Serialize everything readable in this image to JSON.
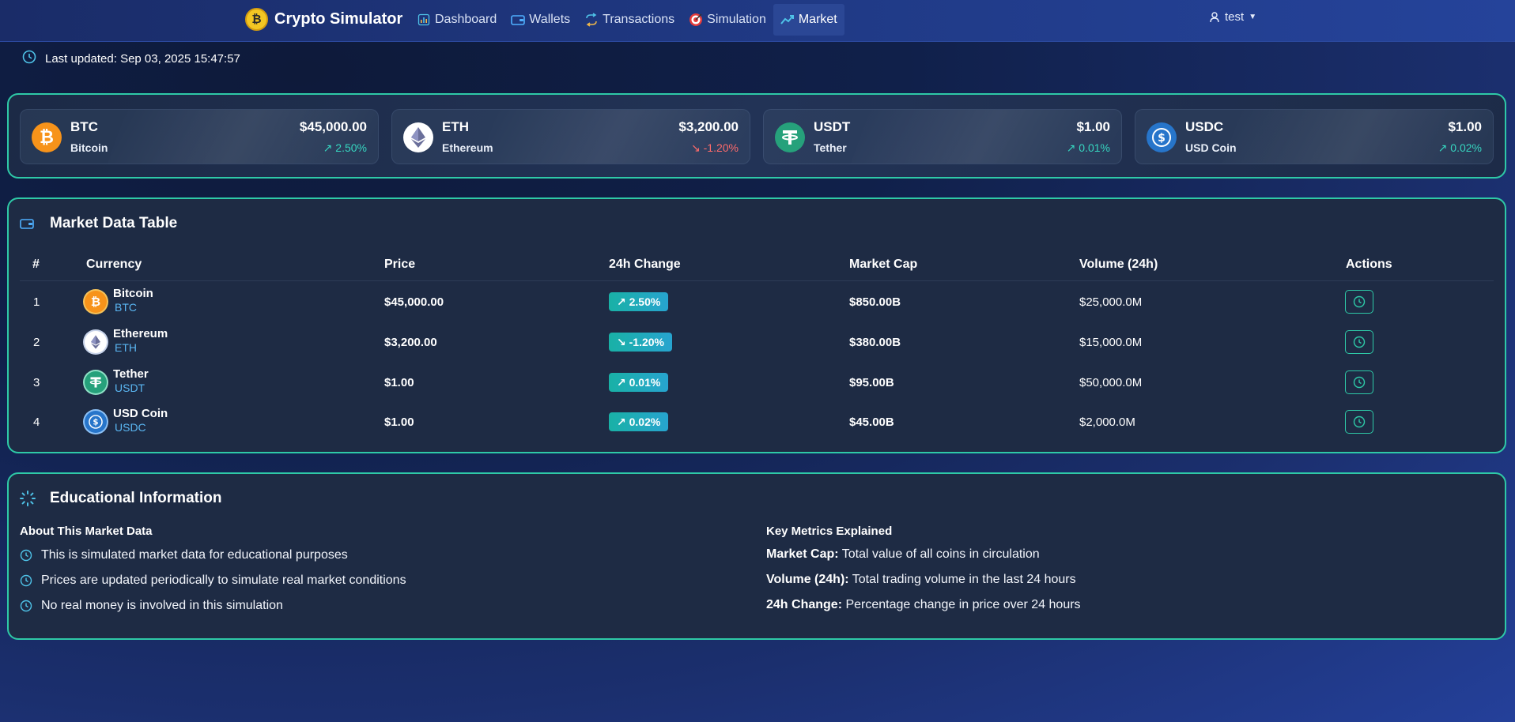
{
  "nav": {
    "brand": "Crypto Simulator",
    "items": [
      {
        "label": "Dashboard",
        "icon": "bar-chart-icon"
      },
      {
        "label": "Wallets",
        "icon": "wallet-icon"
      },
      {
        "label": "Transactions",
        "icon": "arrows-swap-icon"
      },
      {
        "label": "Simulation",
        "icon": "target-icon"
      },
      {
        "label": "Market",
        "icon": "trend-icon"
      }
    ],
    "active": "Market",
    "user": "test"
  },
  "last_updated": "Last updated: Sep 03, 2025 15:47:57",
  "ticker": [
    {
      "symbol": "BTC",
      "name": "Bitcoin",
      "price": "$45,000.00",
      "change": "↗ 2.50%",
      "direction": "up",
      "color": "#f7931a"
    },
    {
      "symbol": "ETH",
      "name": "Ethereum",
      "price": "$3,200.00",
      "change": "↘ -1.20%",
      "direction": "down",
      "color": "#ffffff"
    },
    {
      "symbol": "USDT",
      "name": "Tether",
      "price": "$1.00",
      "change": "↗ 0.01%",
      "direction": "up",
      "color": "#26a17b"
    },
    {
      "symbol": "USDC",
      "name": "USD Coin",
      "price": "$1.00",
      "change": "↗ 0.02%",
      "direction": "up",
      "color": "#2775ca"
    }
  ],
  "market_table": {
    "title": "Market Data Table",
    "columns": [
      "#",
      "Currency",
      "Price",
      "24h Change",
      "Market Cap",
      "Volume (24h)",
      "Actions"
    ],
    "rows": [
      {
        "rank": "1",
        "name": "Bitcoin",
        "symbol": "BTC",
        "price": "$45,000.00",
        "change": "↗ 2.50%",
        "market_cap": "$850.00B",
        "volume": "$25,000.0M"
      },
      {
        "rank": "2",
        "name": "Ethereum",
        "symbol": "ETH",
        "price": "$3,200.00",
        "change": "↘ -1.20%",
        "market_cap": "$380.00B",
        "volume": "$15,000.0M"
      },
      {
        "rank": "3",
        "name": "Tether",
        "symbol": "USDT",
        "price": "$1.00",
        "change": "↗ 0.01%",
        "market_cap": "$95.00B",
        "volume": "$50,000.0M"
      },
      {
        "rank": "4",
        "name": "USD Coin",
        "symbol": "USDC",
        "price": "$1.00",
        "change": "↗ 0.02%",
        "market_cap": "$45.00B",
        "volume": "$2,000.0M"
      }
    ]
  },
  "education": {
    "title": "Educational Information",
    "about_heading": "About This Market Data",
    "about_items": [
      "This is simulated market data for educational purposes",
      "Prices are updated periodically to simulate real market conditions",
      "No real money is involved in this simulation"
    ],
    "metrics_heading": "Key Metrics Explained",
    "metrics": [
      {
        "term": "Market Cap:",
        "desc": "Total value of all coins in circulation"
      },
      {
        "term": "Volume (24h):",
        "desc": "Total trading volume in the last 24 hours"
      },
      {
        "term": "24h Change:",
        "desc": "Percentage change in price over 24 hours"
      }
    ]
  },
  "colors": {
    "accent": "#2ec9a7",
    "up": "#36d6c0",
    "down": "#ff6b6b",
    "link": "#5ab6f2"
  }
}
